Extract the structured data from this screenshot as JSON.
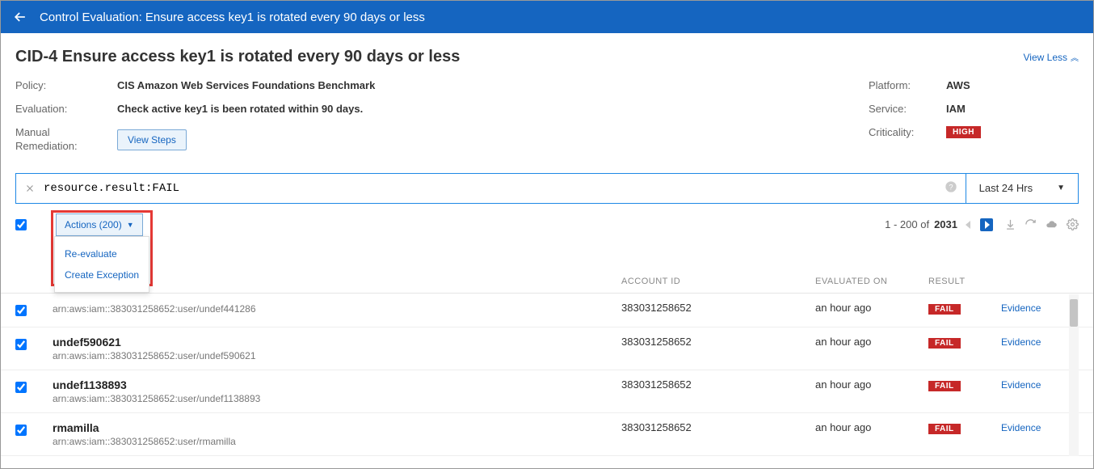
{
  "header": {
    "title": "Control Evaluation: Ensure access key1 is rotated every 90 days or less"
  },
  "page": {
    "title": "CID-4 Ensure access key1 is rotated every 90 days or less",
    "view_less": "View Less"
  },
  "details_left": {
    "policy_label": "Policy:",
    "policy_value": "CIS Amazon Web Services Foundations Benchmark",
    "evaluation_label": "Evaluation:",
    "evaluation_value": "Check active key1 is been rotated within 90 days.",
    "remediation_label": "Manual Remediation:",
    "view_steps_btn": "View Steps"
  },
  "details_right": {
    "platform_label": "Platform:",
    "platform_value": "AWS",
    "service_label": "Service:",
    "service_value": "IAM",
    "criticality_label": "Criticality:",
    "criticality_value": "HIGH"
  },
  "search": {
    "value": "resource.result:FAIL",
    "time_range": "Last 24 Hrs"
  },
  "actions": {
    "button_label": "Actions (200)",
    "menu": [
      "Re-evaluate",
      "Create Exception"
    ]
  },
  "paging": {
    "range": "1 - 200 of",
    "total": "2031"
  },
  "columns": {
    "account": "ACCOUNT ID",
    "evaluated": "EVALUATED ON",
    "result": "RESULT",
    "evidence_label": "Evidence"
  },
  "rows": [
    {
      "name": "",
      "arn": "arn:aws:iam::383031258652:user/undef441286",
      "account": "383031258652",
      "evaluated": "an hour ago",
      "result": "FAIL"
    },
    {
      "name": "undef590621",
      "arn": "arn:aws:iam::383031258652:user/undef590621",
      "account": "383031258652",
      "evaluated": "an hour ago",
      "result": "FAIL"
    },
    {
      "name": "undef1138893",
      "arn": "arn:aws:iam::383031258652:user/undef1138893",
      "account": "383031258652",
      "evaluated": "an hour ago",
      "result": "FAIL"
    },
    {
      "name": "rmamilla",
      "arn": "arn:aws:iam::383031258652:user/rmamilla",
      "account": "383031258652",
      "evaluated": "an hour ago",
      "result": "FAIL"
    }
  ]
}
